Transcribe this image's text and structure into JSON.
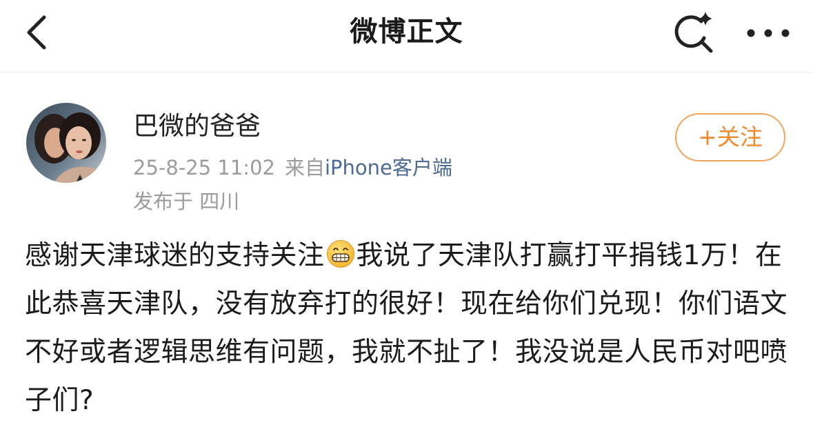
{
  "navbar": {
    "title": "微博正文",
    "back_icon": "chevron-left-icon",
    "search_icon": "search-sparkle-icon",
    "more_icon": "more-horizontal-icon"
  },
  "post": {
    "author": "巴微的爸爸",
    "avatar_icon": "user-avatar-photo",
    "timestamp": "25-8-25 11:02",
    "source_prefix": "来自",
    "source_link": "iPhone客户端",
    "location": "发布于 四川",
    "follow_label": "+关注",
    "body": {
      "before_emoji": "感谢天津球迷的支持关注",
      "emoji": "grinning-emoji",
      "after_emoji": "我说了天津队打赢打平捐钱1万！在此恭喜天津队，没有放弃打的很好！现在给你们兑现！你们语文不好或者逻辑思维有问题，我就不扯了！我没说是人民币对吧喷子们?"
    }
  },
  "colors": {
    "accent_orange": "#ef8a2e",
    "link_blue": "#4d6a94",
    "meta_gray": "#9b9b9b",
    "text_dark": "#1b1b1b"
  }
}
